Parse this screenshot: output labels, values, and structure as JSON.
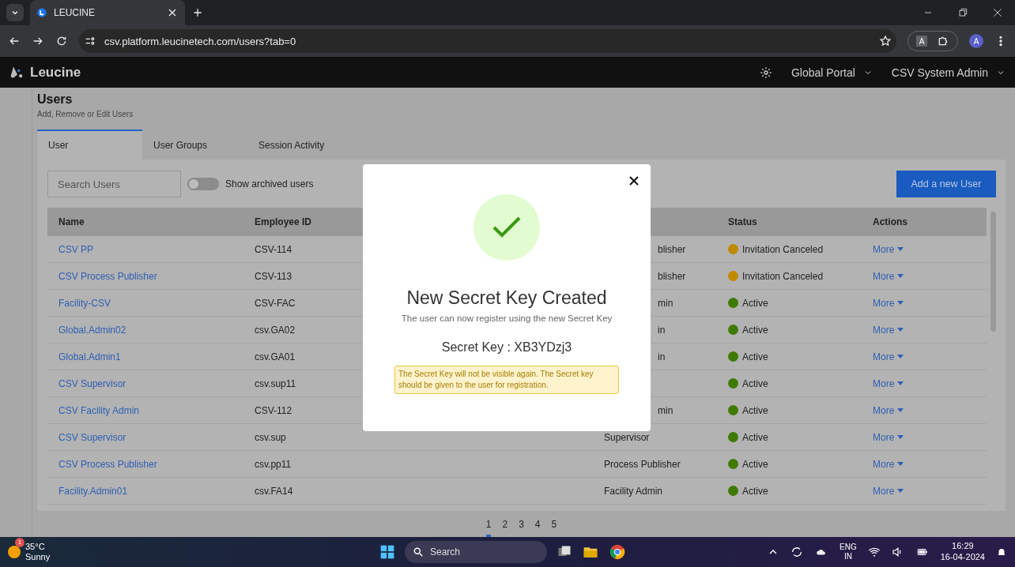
{
  "browser": {
    "tab_title": "LEUCINE",
    "url": "csv.platform.leucinetech.com/users?tab=0",
    "profile_initial": "A",
    "translate_label": "A"
  },
  "app_header": {
    "logo": "Leucine",
    "portal": "Global Portal",
    "role": "CSV System Admin"
  },
  "page": {
    "title": "Users",
    "subtitle": "Add, Remove or Edit Users"
  },
  "tabs": [
    {
      "label": "User",
      "selected": true
    },
    {
      "label": "User Groups",
      "selected": false
    },
    {
      "label": "Session Activity",
      "selected": false
    }
  ],
  "search": {
    "placeholder": "Search Users"
  },
  "archived_toggle": {
    "label": "Show archived users",
    "on": false
  },
  "add_button": "Add a new User",
  "table": {
    "columns": [
      {
        "label": "Name"
      },
      {
        "label": "Employee ID"
      },
      {
        "label": "Status"
      },
      {
        "label": "Actions"
      }
    ],
    "rows": [
      {
        "name": "CSV PP",
        "employee_id": "CSV-114",
        "column_3": "blisher",
        "cut": true,
        "status": "Invitation Canceled",
        "color": "#c08a00",
        "action": "More"
      },
      {
        "name": "CSV Process Publisher",
        "employee_id": "CSV-113",
        "column_3": "blisher",
        "cut": true,
        "status": "Invitation Canceled",
        "color": "#c08a00",
        "action": "More"
      },
      {
        "name": "Facility-CSV",
        "employee_id": "CSV-FAC",
        "column_3": "min",
        "cut": true,
        "status": "Active",
        "color": "#3f7a00",
        "action": "More"
      },
      {
        "name": "Global.Admin02",
        "employee_id": "csv.GA02",
        "column_3": "in",
        "cut": true,
        "status": "Active",
        "color": "#3f7a00",
        "action": "More"
      },
      {
        "name": "Global.Admin1",
        "employee_id": "csv.GA01",
        "column_3": "in",
        "cut": true,
        "status": "Active",
        "color": "#3f7a00",
        "action": "More"
      },
      {
        "name": "CSV Supervisor",
        "employee_id": "csv.sup11",
        "status": "Active",
        "color": "#3f7a00",
        "action": "More"
      },
      {
        "name": "CSV Facility Admin",
        "employee_id": "CSV-112",
        "column_3": "min",
        "cut": true,
        "status": "Active",
        "color": "#3f7a00",
        "action": "More"
      },
      {
        "name": "CSV Supervisor",
        "employee_id": "csv.sup",
        "column_3": "Supervisor",
        "cut": false,
        "status": "Active",
        "color": "#3f7a00",
        "action": "More"
      },
      {
        "name": "CSV Process Publisher",
        "employee_id": "csv.pp11",
        "column_3": "Process Publisher",
        "cut": false,
        "status": "Active",
        "color": "#3f7a00",
        "action": "More"
      },
      {
        "name": "Facility.Admin01",
        "employee_id": "csv.FA14",
        "column_3": "Facility Admin",
        "cut": false,
        "status": "Active",
        "color": "#3f7a00",
        "action": "More"
      }
    ]
  },
  "pagination": [
    {
      "label": "1",
      "selected": true
    },
    {
      "label": "2",
      "selected": false
    },
    {
      "label": "3",
      "selected": false
    },
    {
      "label": "4",
      "selected": false
    },
    {
      "label": "5",
      "selected": false
    }
  ],
  "modal": {
    "title": "New Secret Key Created",
    "subtitle": "The user can now register using the new Secret Key",
    "secret_key": "Secret Key : XB3YDzj3",
    "warning": "The Secret Key will not be visible again. The Secret key should be given to the user for registration."
  },
  "taskbar": {
    "weather_badge": "1",
    "temperature": "35°C",
    "condition": "Sunny",
    "search": "Search",
    "language": "ENG",
    "region": "IN",
    "time": "16:29",
    "date": "16-04-2024"
  }
}
